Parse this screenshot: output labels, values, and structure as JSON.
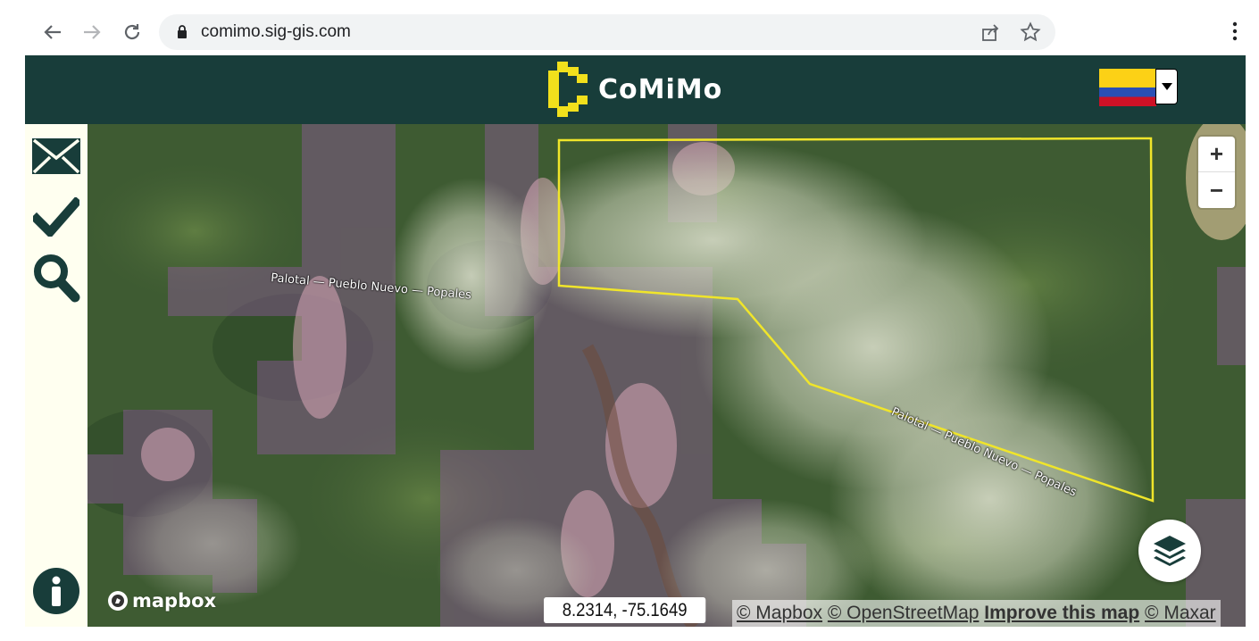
{
  "browser": {
    "url": "comimo.sig-gis.com"
  },
  "app": {
    "title": "CoMiMo",
    "brand_color": "#183d3a",
    "logo_color": "#f2e01c",
    "language_flag": "colombia-flag-icon"
  },
  "sidebar": {
    "items": [
      {
        "icon": "envelope-icon"
      },
      {
        "icon": "checkmark-icon"
      },
      {
        "icon": "search-icon"
      }
    ],
    "info_icon": "info-icon"
  },
  "map": {
    "road_label_1": "Palotal — Pueblo Nuevo — Popales",
    "road_label_2": "Palotal — Pueblo Nuevo — Popales",
    "zoom_in": "+",
    "zoom_out": "−",
    "mapbox_logo": "mapbox",
    "coordinates": "8.2314, -75.1649",
    "attribution": {
      "mapbox": "© Mapbox",
      "osm": "© OpenStreetMap",
      "improve": "Improve this map",
      "maxar": "© Maxar"
    },
    "boundary_color": "#f0e52a",
    "overlay_color": "#8e5a9a"
  }
}
